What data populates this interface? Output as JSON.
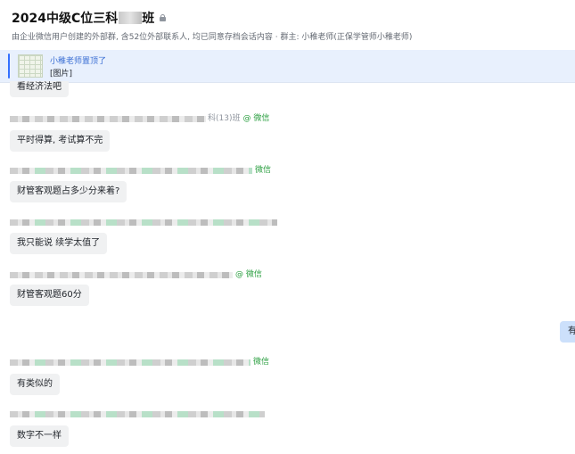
{
  "header": {
    "title": "2024中级C位三科",
    "title_tail": "班",
    "subtitle": "由企业微信用户创建的外部群, 含52位外部联系人, 均已同意存档会话内容 · 群主: 小稚老师(正保学管师小稚老师)"
  },
  "pinned": {
    "title": "小稚老师置顶了",
    "content": "[图片]"
  },
  "messages": [
    {
      "text": "看经济法吧"
    },
    {
      "sender_suffix": "科(13)班",
      "source": "@ 微信",
      "text": "平时得算, 考试算不完"
    },
    {
      "source": "微信",
      "text": "财管客观题占多少分来着?"
    },
    {
      "text": "我只能说 续学太值了"
    },
    {
      "source": "@ 微信",
      "text": "财管客观题60分"
    },
    {
      "source": "微信",
      "text": "有类似的"
    },
    {
      "text": "数字不一样"
    }
  ],
  "self_message": {
    "text": "有"
  },
  "colors": {
    "pinned_bg": "#e8f0fd",
    "accent": "#3370ff",
    "wechat_green": "#2ea043",
    "bubble_other": "#f0f1f2",
    "bubble_self": "#cce0fb"
  }
}
